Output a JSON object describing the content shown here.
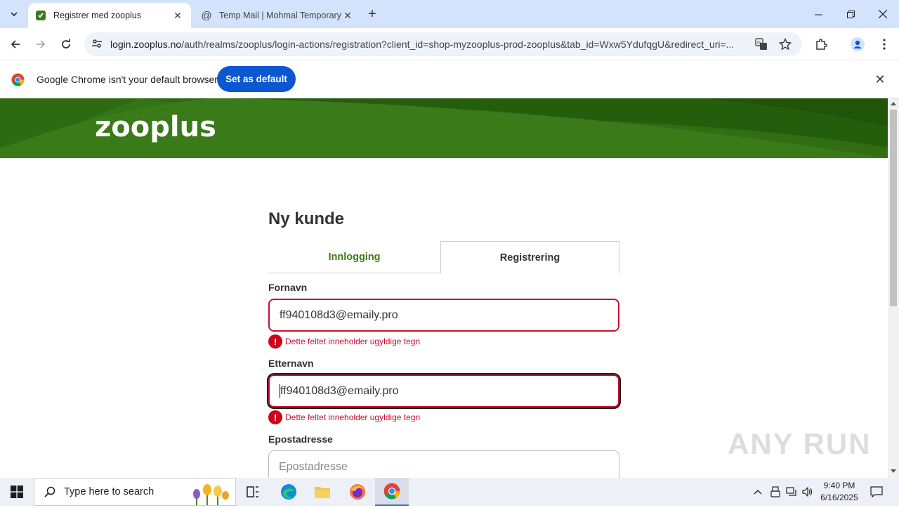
{
  "browser": {
    "tabs": [
      {
        "title": "Registrer med zooplus",
        "active": true
      },
      {
        "title": "Temp Mail | Mohmal Temporary",
        "active": false
      }
    ],
    "url_host": "login.zooplus.no",
    "url_path": "/auth/realms/zooplus/login-actions/registration?client_id=shop-myzooplus-prod-zooplus&tab_id=Wxw5YdufqgU&redirect_uri=...",
    "infobar": {
      "message": "Google Chrome isn't your default browser",
      "button": "Set as default"
    }
  },
  "page": {
    "logo": "zooplus",
    "title": "Ny kunde",
    "tabs": {
      "login": "Innlogging",
      "register": "Registrering"
    },
    "form": {
      "firstname_label": "Fornavn",
      "firstname_value": "ff940108d3@emaily.pro",
      "firstname_error": "Dette feltet inneholder ugyldige tegn",
      "lastname_label": "Etternavn",
      "lastname_value": "ff940108d3@emaily.pro",
      "lastname_error": "Dette feltet inneholder ugyldige tegn",
      "email_label": "Epostadresse",
      "email_placeholder": "Epostadresse"
    },
    "watermark": "ANY RUN"
  },
  "taskbar": {
    "search_placeholder": "Type here to search",
    "time": "9:40 PM",
    "date": "6/16/2025"
  },
  "colors": {
    "brand_green": "#3b7a1a",
    "tab_green": "#3c7a12",
    "error_red": "#c8102e",
    "chrome_blue": "#0b57d0"
  }
}
